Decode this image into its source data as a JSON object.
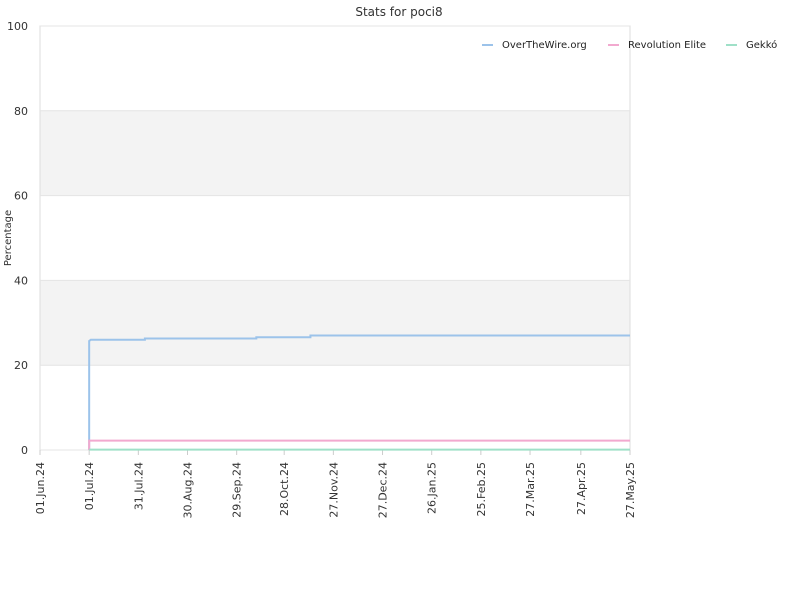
{
  "chart_data": {
    "type": "line",
    "title": "Stats for poci8",
    "xlabel": "",
    "ylabel": "Percentage",
    "ylim": [
      0,
      100
    ],
    "y_ticks": [
      "0",
      "20",
      "40",
      "60",
      "80",
      "100"
    ],
    "x_ticks": [
      "01.Jun.24",
      "01.Jul.24",
      "31.Jul.24",
      "30.Aug.24",
      "29.Sep.24",
      "28.Oct.24",
      "27.Nov.24",
      "27.Dec.24",
      "26.Jan.25",
      "25.Feb.25",
      "27.Mar.25",
      "27.Apr.25",
      "27.May.25"
    ],
    "x_range": [
      "2024-06-01",
      "2025-05-27"
    ],
    "grid": "horizontal bands",
    "legend_position": "top-right",
    "series": [
      {
        "name": "OverTheWire.org",
        "color": "#9cc3ea",
        "step": true,
        "points": [
          [
            "2024-07-01",
            0
          ],
          [
            "2024-07-01",
            25.7
          ],
          [
            "2024-07-02",
            26.0
          ],
          [
            "2024-08-04",
            26.0
          ],
          [
            "2024-08-04",
            26.3
          ],
          [
            "2024-10-11",
            26.3
          ],
          [
            "2024-10-11",
            26.6
          ],
          [
            "2024-11-13",
            26.6
          ],
          [
            "2024-11-13",
            27.0
          ],
          [
            "2025-05-27",
            27.0
          ]
        ]
      },
      {
        "name": "Revolution Elite",
        "color": "#f2a9cf",
        "step": true,
        "points": [
          [
            "2024-07-01",
            0
          ],
          [
            "2024-07-01",
            2.2
          ],
          [
            "2025-05-27",
            2.2
          ]
        ]
      },
      {
        "name": "Gekkó",
        "color": "#9fe0c8",
        "step": true,
        "points": [
          [
            "2024-07-01",
            0.1
          ],
          [
            "2025-05-27",
            0.1
          ]
        ]
      }
    ]
  }
}
